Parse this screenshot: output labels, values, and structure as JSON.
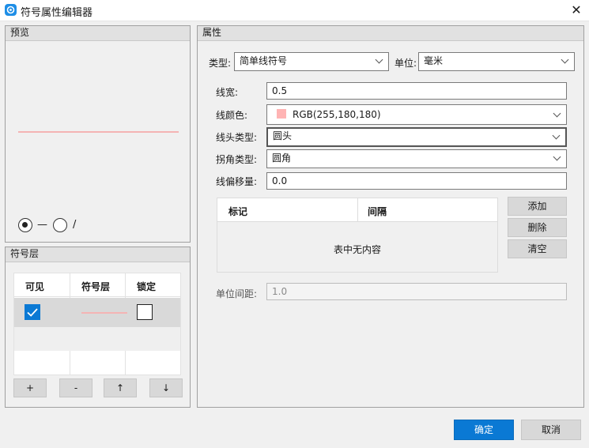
{
  "window": {
    "title": "符号属性编辑器",
    "close": "✕"
  },
  "preview": {
    "header": "预览",
    "line_color": "#f4b4b4",
    "radio1_label": "—",
    "radio2_label": "/",
    "selected": 1
  },
  "layers": {
    "header": "符号层",
    "columns": [
      "可见",
      "符号层",
      "锁定"
    ],
    "rows": [
      {
        "visible": true,
        "locked": false
      }
    ],
    "buttons": [
      "+",
      "-",
      "↑",
      "↓"
    ]
  },
  "properties": {
    "header": "属性",
    "type_label": "类型:",
    "type_value": "简单线符号",
    "unit_label": "单位:",
    "unit_value": "毫米",
    "width_label": "线宽:",
    "width_value": "0.5",
    "color_label": "线颜色:",
    "color_value": "RGB(255,180,180)",
    "color_swatch": "#ffb4b4",
    "head_label": "线头类型:",
    "head_value": "圆头",
    "corner_label": "拐角类型:",
    "corner_value": "圆角",
    "offset_label": "线偏移量:",
    "offset_value": "0.0",
    "table_columns": [
      "标记",
      "间隔"
    ],
    "table_empty": "表中无内容",
    "add_button": "添加",
    "delete_button": "删除",
    "clear_button": "清空",
    "interval_label": "单位间距:",
    "interval_value": "1.0"
  },
  "footer": {
    "ok": "确定",
    "cancel": "取消"
  },
  "colors": {
    "accent": "#0a79d4",
    "selection_row": "#d9d9d9",
    "checkbox_checked": "#0a79d4"
  }
}
